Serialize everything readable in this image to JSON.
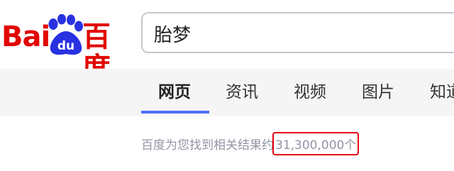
{
  "logo": {
    "left_text": "Bai",
    "paw_text": "du",
    "right_text": "百度",
    "brand_red": "#e10601",
    "paw_blue": "#2932e1"
  },
  "search": {
    "value": "胎梦"
  },
  "tabs": [
    {
      "label": "网页",
      "active": true
    },
    {
      "label": "资讯",
      "active": false
    },
    {
      "label": "视频",
      "active": false
    },
    {
      "label": "图片",
      "active": false
    },
    {
      "label": "知道",
      "active": false
    }
  ],
  "results": {
    "prefix": "百度为您找到相关结果约",
    "count": "31,300,000个"
  },
  "colors": {
    "accent": "#4e6ef2",
    "highlight_border": "#e60012",
    "nav_bg": "#f5f5f6"
  }
}
